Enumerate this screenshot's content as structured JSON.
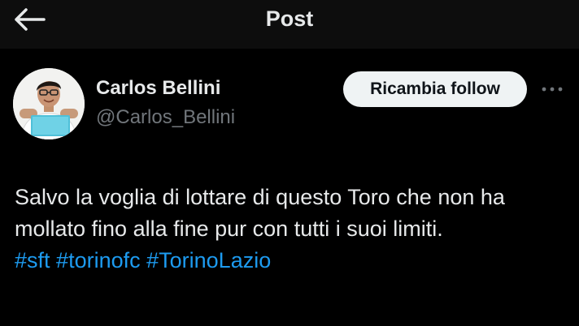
{
  "header": {
    "title": "Post",
    "back_icon": "arrow-left-icon"
  },
  "author": {
    "name": "Carlos Bellini",
    "handle": "@Carlos_Bellini",
    "avatar": "avatar-photo"
  },
  "follow_button": {
    "label": "Ricambia follow"
  },
  "more_icon": "more-horizontal-icon",
  "post": {
    "text": "Salvo la voglia di lottare di questo Toro che non ha mollato fino alla fine pur con tutti i suoi limiti.",
    "hashtags": [
      "#sft",
      "#torinofc",
      "#TorinoLazio"
    ]
  },
  "colors": {
    "background": "#000000",
    "topbar": "#0d0d0d",
    "text_primary": "#e7e9ea",
    "text_secondary": "#71767b",
    "link": "#1d9bf0",
    "button_bg": "#eff3f4",
    "button_text": "#0f1419"
  }
}
